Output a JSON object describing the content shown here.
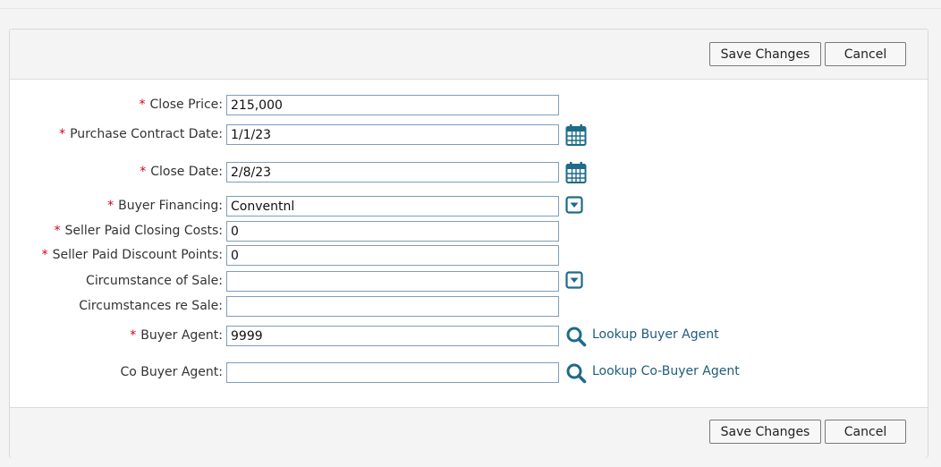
{
  "toolbar": {
    "save_label": "Save Changes",
    "cancel_label": "Cancel"
  },
  "form": {
    "required_mark": "*",
    "close_price": {
      "label": "Close Price:",
      "value": "215,000"
    },
    "purchase_contract_date": {
      "label": "Purchase Contract Date:",
      "value": "1/1/23",
      "icon": "calendar-icon"
    },
    "close_date": {
      "label": "Close Date:",
      "value": "2/8/23",
      "icon": "calendar-icon"
    },
    "buyer_financing": {
      "label": "Buyer Financing:",
      "value": "Conventnl",
      "icon": "dropdown-icon"
    },
    "seller_paid_closing_costs": {
      "label": "Seller Paid Closing Costs:",
      "value": "0"
    },
    "seller_paid_discount_points": {
      "label": "Seller Paid Discount Points:",
      "value": "0"
    },
    "circumstance_of_sale": {
      "label": "Circumstance of Sale:",
      "value": "",
      "icon": "dropdown-icon"
    },
    "circumstances_re_sale": {
      "label": "Circumstances re Sale:",
      "value": ""
    },
    "buyer_agent": {
      "label": "Buyer Agent:",
      "value": "9999",
      "icon": "search-icon",
      "link": "Lookup Buyer Agent"
    },
    "co_buyer_agent": {
      "label": "Co Buyer Agent:",
      "value": "",
      "icon": "search-icon",
      "link": "Lookup Co-Buyer Agent"
    }
  },
  "colors": {
    "required": "#d0021b",
    "icon": "#1e6b8a",
    "link": "#1e5d7a",
    "input_border": "#7f9db9"
  }
}
